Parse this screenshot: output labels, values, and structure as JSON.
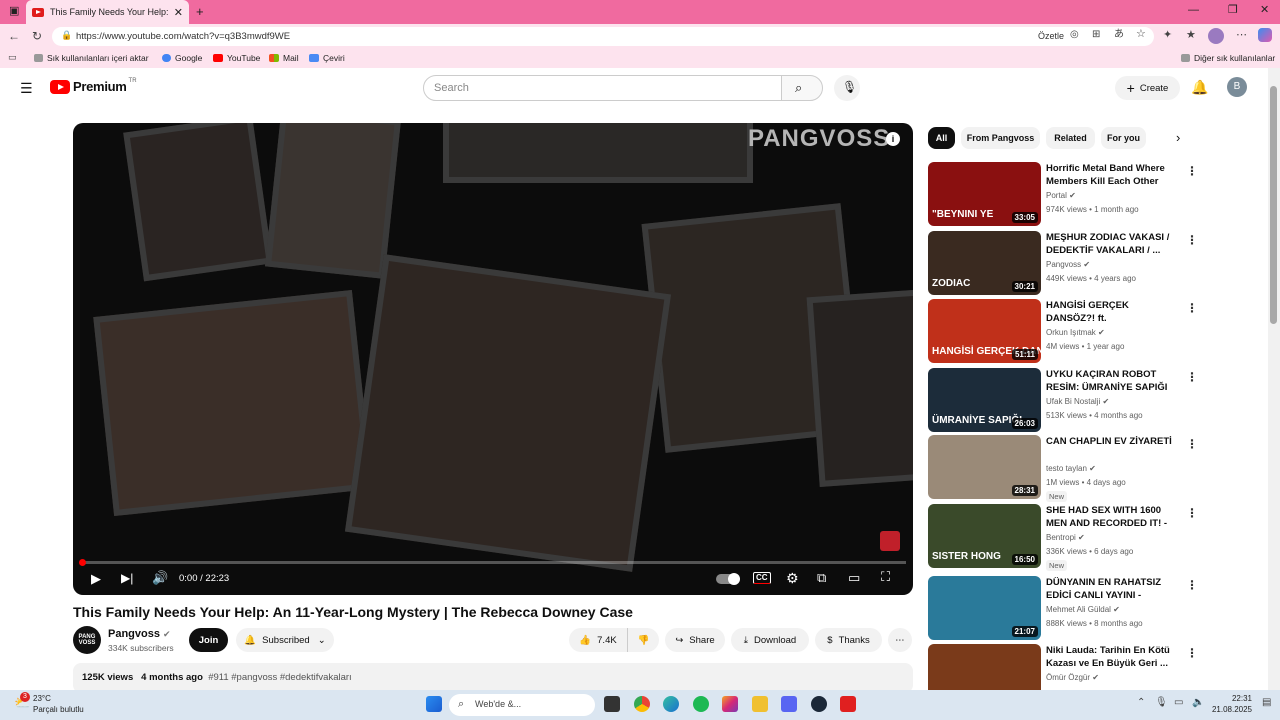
{
  "browser": {
    "tab_title": "This Family Needs Your Help: An",
    "url": "https://www.youtube.com/watch?v=q3B3mwdf9WE",
    "summarize_label": "Özetle",
    "bookmarks": [
      "Sık kullanılanları içeri aktar",
      "Google",
      "YouTube",
      "Mail",
      "Çeviri"
    ],
    "other_bookmarks": "Diğer sık kullanılanlar"
  },
  "youtube": {
    "logo_text": "Premium",
    "logo_region": "TR",
    "search_placeholder": "Search",
    "create_label": "Create",
    "avatar_letter": "B"
  },
  "player": {
    "watermark": "PANGVOSS",
    "time": "0:00 / 22:23",
    "progress": 0.0
  },
  "video": {
    "title": "This Family Needs Your Help: An 11-Year-Long Mystery | The Rebecca Downey Case",
    "channel_name": "Pangvoss",
    "channel_avatar_text": "PANG VOSS",
    "subscribers": "334K subscribers",
    "join_label": "Join",
    "subscribed_label": "Subscribed",
    "likes": "7.4K",
    "share_label": "Share",
    "download_label": "Download",
    "thanks_label": "Thanks",
    "views": "125K views",
    "age": "4 months ago",
    "tags": "#911 #pangvoss #dedektifvakaları"
  },
  "sidebar": {
    "chips": [
      "All",
      "From Pangvoss",
      "Related",
      "For you"
    ],
    "recommendations": [
      {
        "title": "Horrific Metal Band Where Members Kill Each Other",
        "channel": "Portal",
        "meta": "974K views • 1 month ago",
        "duration": "33:05",
        "new": "",
        "thumb_text": "\"BEYNINI YE",
        "color": "#8a1010"
      },
      {
        "title": "MEŞHUR ZODIAC VAKASI / DEDEKTİF VAKALARI / ...",
        "channel": "Pangvoss",
        "meta": "449K views • 4 years ago",
        "duration": "30:21",
        "new": "",
        "thumb_text": "ZODIAC",
        "color": "#3a2a20"
      },
      {
        "title": "HANGİSİ GERÇEK DANSÖZ?! ft. @AyniSinemalar",
        "channel": "Orkun Işıtmak",
        "meta": "4M views • 1 year ago",
        "duration": "51:11",
        "new": "",
        "thumb_text": "HANGİSİ GERÇEK DANSÖZ",
        "color": "#c0301a"
      },
      {
        "title": "UYKU KAÇIRAN ROBOT RESİM: ÜMRANİYE SAPIĞI",
        "channel": "Ufak Bi Nostalji",
        "meta": "513K views • 4 months ago",
        "duration": "26:03",
        "new": "",
        "thumb_text": "ÜMRANİYE SAPIĞI",
        "color": "#1c2c3a"
      },
      {
        "title": "CAN CHAPLIN EV ZİYARETİ",
        "channel": "testo taylan",
        "meta": "1M views • 4 days ago",
        "duration": "28:31",
        "new": "New",
        "thumb_text": "",
        "color": "#9a8a78"
      },
      {
        "title": "SHE HAD SEX WITH 1600 MEN AND RECORDED IT! - Sister ...",
        "channel": "Bentropi",
        "meta": "336K views • 6 days ago",
        "duration": "16:50",
        "new": "New",
        "thumb_text": "SISTER HONG",
        "color": "#3a4a2a"
      },
      {
        "title": "DÜNYANIN EN RAHATSIZ EDİCİ CANLI YAYINI - \"Milyonlarca ...",
        "channel": "Mehmet Ali Güldal",
        "meta": "888K views • 8 months ago",
        "duration": "21:07",
        "new": "",
        "thumb_text": "",
        "color": "#2a7a9a"
      },
      {
        "title": "Niki Lauda: Tarihin En Kötü Kazası ve En Büyük Geri ...",
        "channel": "Ömür Özgür",
        "meta": "",
        "duration": "",
        "new": "",
        "thumb_text": "",
        "color": "#7a3a1a"
      }
    ]
  },
  "taskbar": {
    "temp": "23°C",
    "weather": "Parçalı bulutlu",
    "search": "Web'de &...",
    "time": "22:31",
    "date": "21.08.2025",
    "badge": "3"
  },
  "colors": {
    "tabbar": "#f06a9f",
    "chrome": "#fde3ee",
    "accent": "#ff0000"
  }
}
